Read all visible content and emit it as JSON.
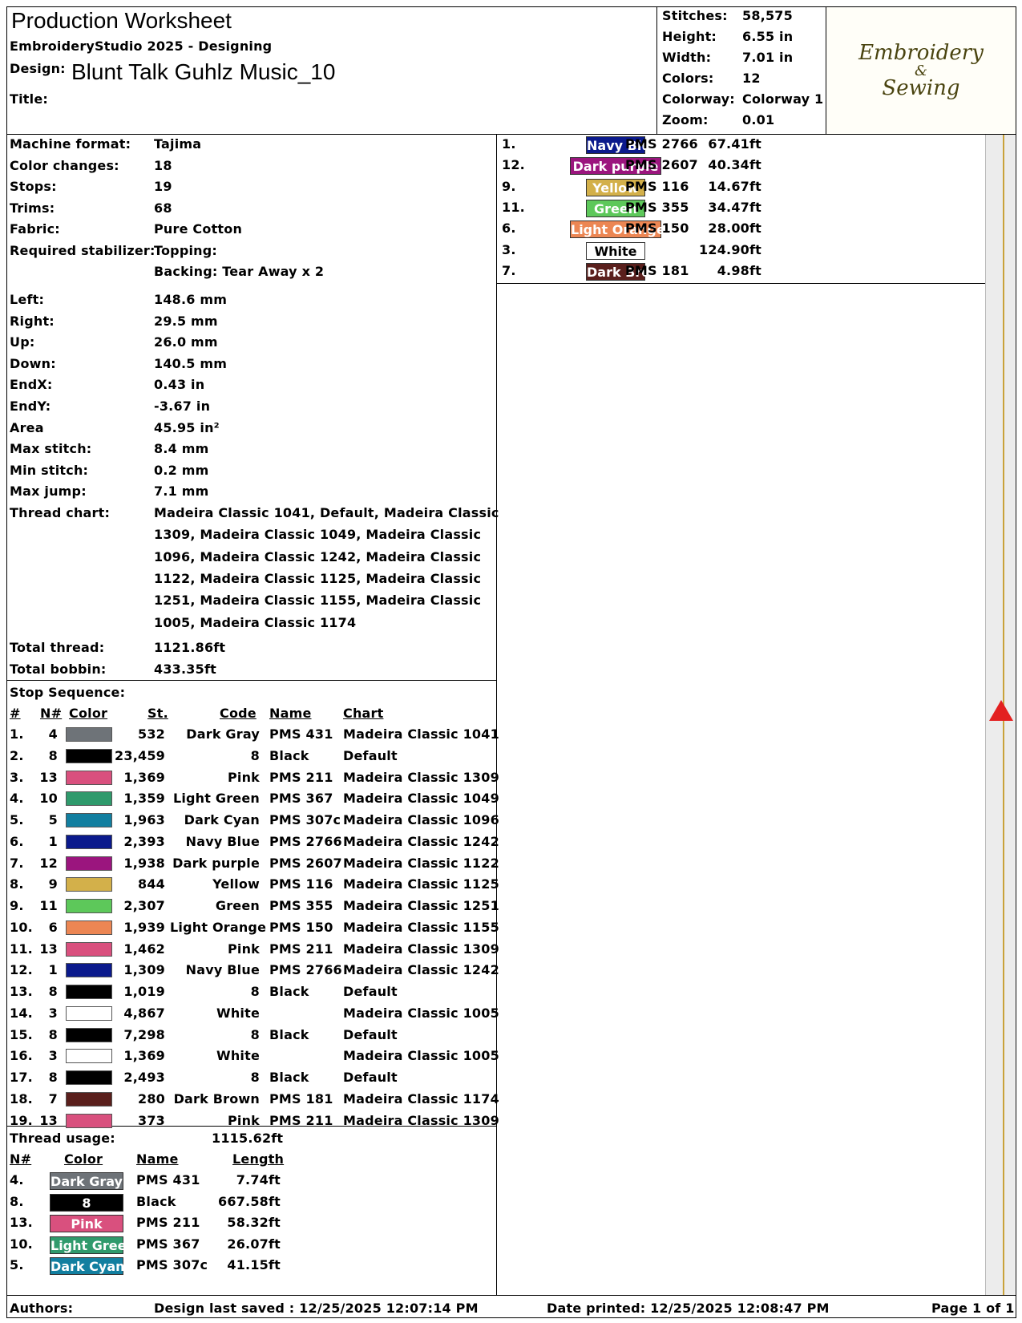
{
  "header": {
    "title": "Production Worksheet",
    "software": "EmbroideryStudio 2025 - Designing",
    "design_label": "Design:",
    "design_name": "Blunt Talk Guhlz Music_10",
    "title_label": "Title:",
    "title_value": ""
  },
  "summary": [
    {
      "label": "Stitches:",
      "value": "58,575"
    },
    {
      "label": "Height:",
      "value": "6.55 in"
    },
    {
      "label": "Width:",
      "value": "7.01 in"
    },
    {
      "label": "Colors:",
      "value": "12"
    },
    {
      "label": "Colorway:",
      "value": "Colorway 1"
    },
    {
      "label": "Zoom:",
      "value": "0.01"
    }
  ],
  "logo": {
    "line1": "Embroidery",
    "line2": "&",
    "line3": "Sewing"
  },
  "details": [
    {
      "label": "Machine format:",
      "value": "Tajima"
    },
    {
      "label": "Color changes:",
      "value": "18"
    },
    {
      "label": "Stops:",
      "value": "19"
    },
    {
      "label": "Trims:",
      "value": "68"
    },
    {
      "label": "Fabric:",
      "value": "Pure Cotton"
    },
    {
      "label": "Required stabilizer:",
      "value": "Topping:"
    },
    {
      "label": "",
      "value": "Backing: Tear Away x 2"
    }
  ],
  "dimensions": [
    {
      "label": "Left:",
      "value": "148.6 mm"
    },
    {
      "label": "Right:",
      "value": "29.5 mm"
    },
    {
      "label": "Up:",
      "value": "26.0 mm"
    },
    {
      "label": "Down:",
      "value": "140.5 mm"
    },
    {
      "label": "EndX:",
      "value": "0.43 in"
    },
    {
      "label": "EndY:",
      "value": "-3.67 in"
    },
    {
      "label": "Area",
      "value": " 45.95 in²"
    },
    {
      "label": "Max stitch:",
      "value": "8.4 mm"
    },
    {
      "label": "Min stitch:",
      "value": "0.2 mm"
    },
    {
      "label": "Max jump:",
      "value": "7.1 mm"
    }
  ],
  "thread_chart": {
    "label": "Thread chart:",
    "lines": [
      "Madeira Classic 1041, Default, Madeira Classic",
      "1309, Madeira Classic 1049, Madeira Classic",
      "1096, Madeira Classic 1242, Madeira Classic",
      "1122, Madeira Classic 1125, Madeira Classic",
      "1251, Madeira Classic 1155, Madeira Classic",
      "1005, Madeira Classic 1174"
    ]
  },
  "totals": [
    {
      "label": "Total thread:",
      "value": "1121.86ft"
    },
    {
      "label": "Total bobbin:",
      "value": "433.35ft"
    }
  ],
  "stop_sequence": {
    "title": "Stop Sequence:",
    "headers": {
      "num": "#",
      "n": "N#",
      "color": "Color",
      "st": "St.",
      "code": "Code",
      "name": "Name",
      "chart": "Chart"
    },
    "rows": [
      {
        "num": "1.",
        "n": "4",
        "color": "#6e7378",
        "st": "532",
        "code": "Dark Gray",
        "name": "PMS 431",
        "chart": "Madeira Classic 1041"
      },
      {
        "num": "2.",
        "n": "8",
        "color": "#000000",
        "st": "23,459",
        "code": "8",
        "name": "Black",
        "chart": "Default"
      },
      {
        "num": "3.",
        "n": "13",
        "color": "#d9507e",
        "st": "1,369",
        "code": "Pink",
        "name": "PMS 211",
        "chart": "Madeira Classic 1309"
      },
      {
        "num": "4.",
        "n": "10",
        "color": "#2f9a6c",
        "st": "1,359",
        "code": "Light Green",
        "name": "PMS 367",
        "chart": "Madeira Classic 1049"
      },
      {
        "num": "5.",
        "n": "5",
        "color": "#127fa0",
        "st": "1,963",
        "code": "Dark Cyan",
        "name": "PMS 307c",
        "chart": "Madeira Classic 1096"
      },
      {
        "num": "6.",
        "n": "1",
        "color": "#0b1a8c",
        "st": "2,393",
        "code": "Navy Blue",
        "name": "PMS 2766",
        "chart": "Madeira Classic 1242"
      },
      {
        "num": "7.",
        "n": "12",
        "color": "#9b157e",
        "st": "1,938",
        "code": "Dark purple",
        "name": "PMS 2607",
        "chart": "Madeira Classic 1122"
      },
      {
        "num": "8.",
        "n": "9",
        "color": "#d3b04a",
        "st": "844",
        "code": "Yellow",
        "name": "PMS 116",
        "chart": "Madeira Classic 1125"
      },
      {
        "num": "9.",
        "n": "11",
        "color": "#5dc85a",
        "st": "2,307",
        "code": "Green",
        "name": "PMS 355",
        "chart": "Madeira Classic 1251"
      },
      {
        "num": "10.",
        "n": "6",
        "color": "#ec8653",
        "st": "1,939",
        "code": "Light Orange",
        "name": "PMS 150",
        "chart": "Madeira Classic 1155"
      },
      {
        "num": "11.",
        "n": "13",
        "color": "#d9507e",
        "st": "1,462",
        "code": "Pink",
        "name": "PMS 211",
        "chart": "Madeira Classic 1309"
      },
      {
        "num": "12.",
        "n": "1",
        "color": "#0b1a8c",
        "st": "1,309",
        "code": "Navy Blue",
        "name": "PMS 2766",
        "chart": "Madeira Classic 1242"
      },
      {
        "num": "13.",
        "n": "8",
        "color": "#000000",
        "st": "1,019",
        "code": "8",
        "name": "Black",
        "chart": "Default"
      },
      {
        "num": "14.",
        "n": "3",
        "color": "#ffffff",
        "st": "4,867",
        "code": "White",
        "name": "",
        "chart": "Madeira Classic 1005"
      },
      {
        "num": "15.",
        "n": "8",
        "color": "#000000",
        "st": "7,298",
        "code": "8",
        "name": "Black",
        "chart": "Default"
      },
      {
        "num": "16.",
        "n": "3",
        "color": "#ffffff",
        "st": "1,369",
        "code": "White",
        "name": "",
        "chart": "Madeira Classic 1005"
      },
      {
        "num": "17.",
        "n": "8",
        "color": "#000000",
        "st": "2,493",
        "code": "8",
        "name": "Black",
        "chart": "Default"
      },
      {
        "num": "18.",
        "n": "7",
        "color": "#5a1f1c",
        "st": "280",
        "code": "Dark Brown",
        "name": "PMS 181",
        "chart": "Madeira Classic 1174"
      },
      {
        "num": "19.",
        "n": "13",
        "color": "#d9507e",
        "st": "373",
        "code": "Pink",
        "name": "PMS 211",
        "chart": "Madeira Classic 1309"
      }
    ]
  },
  "thread_usage": {
    "title": "Thread usage:",
    "total": "1115.62ft",
    "headers": {
      "n": "N#",
      "color": "Color",
      "name": "Name",
      "length": "Length"
    },
    "rows": [
      {
        "n": "4.",
        "chip": "Dark Gray",
        "color": "#6e7378",
        "name": "PMS 431",
        "length": "7.74ft"
      },
      {
        "n": "8.",
        "chip": "8",
        "color": "#000000",
        "name": "Black",
        "length": "667.58ft"
      },
      {
        "n": "13.",
        "chip": "Pink",
        "color": "#d9507e",
        "name": "PMS 211",
        "length": "58.32ft"
      },
      {
        "n": "10.",
        "chip": "Light Green",
        "color": "#2f9a6c",
        "name": "PMS 367",
        "length": "26.07ft"
      },
      {
        "n": "5.",
        "chip": "Dark Cyan",
        "color": "#127fa0",
        "name": "PMS 307c",
        "length": "41.15ft"
      }
    ]
  },
  "thread_usage_right": [
    {
      "n": "1.",
      "chip": "Navy Blue",
      "color": "#0b1a8c",
      "name": "PMS 2766",
      "length": "67.41ft"
    },
    {
      "n": "12.",
      "chip": "Dark purple",
      "color": "#9b157e",
      "name": "PMS 2607",
      "length": "40.34ft"
    },
    {
      "n": "9.",
      "chip": "Yellow",
      "color": "#d3b04a",
      "name": "PMS 116",
      "length": "14.67ft"
    },
    {
      "n": "11.",
      "chip": "Green",
      "color": "#5dc85a",
      "name": "PMS 355",
      "length": "34.47ft"
    },
    {
      "n": "6.",
      "chip": "Light Orange",
      "color": "#ec8653",
      "name": "PMS 150",
      "length": "28.00ft"
    },
    {
      "n": "3.",
      "chip": "White",
      "color": "#ffffff",
      "name": "",
      "length": "124.90ft"
    },
    {
      "n": "7.",
      "chip": "Dark Brown",
      "color": "#5a1f1c",
      "name": "PMS 181",
      "length": "4.98ft"
    }
  ],
  "footer": {
    "authors": "Authors:",
    "saved": "Design last saved : 12/25/2025 12:07:14 PM",
    "printed": "Date printed: 12/25/2025 12:08:47 PM",
    "page": "Page 1 of 1"
  }
}
